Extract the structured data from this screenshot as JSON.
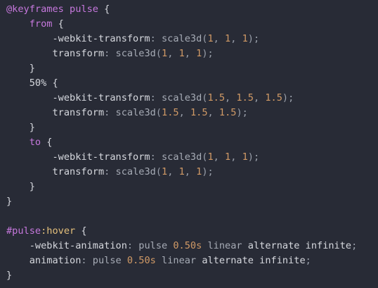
{
  "colors": {
    "background": "#282b36",
    "keyword": "#c678dd",
    "number": "#d19a66",
    "text": "#d6d8de",
    "muted": "#a7acb6",
    "pseudo": "#e5c07b"
  },
  "lines": [
    [
      {
        "t": "@keyframes",
        "c": "kw"
      },
      {
        "t": " "
      },
      {
        "t": "pulse",
        "c": "sel"
      },
      {
        "t": " {",
        "c": "plain"
      }
    ],
    [
      {
        "t": "    "
      },
      {
        "t": "from",
        "c": "kw"
      },
      {
        "t": " {",
        "c": "plain"
      }
    ],
    [
      {
        "t": "        "
      },
      {
        "t": "-webkit-transform",
        "c": "prop"
      },
      {
        "t": ": ",
        "c": "punc"
      },
      {
        "t": "scale3d",
        "c": "fn"
      },
      {
        "t": "(",
        "c": "punc"
      },
      {
        "t": "1",
        "c": "num"
      },
      {
        "t": ", ",
        "c": "punc"
      },
      {
        "t": "1",
        "c": "num"
      },
      {
        "t": ", ",
        "c": "punc"
      },
      {
        "t": "1",
        "c": "num"
      },
      {
        "t": ");",
        "c": "punc"
      }
    ],
    [
      {
        "t": "        "
      },
      {
        "t": "transform",
        "c": "prop"
      },
      {
        "t": ": ",
        "c": "punc"
      },
      {
        "t": "scale3d",
        "c": "fn"
      },
      {
        "t": "(",
        "c": "punc"
      },
      {
        "t": "1",
        "c": "num"
      },
      {
        "t": ", ",
        "c": "punc"
      },
      {
        "t": "1",
        "c": "num"
      },
      {
        "t": ", ",
        "c": "punc"
      },
      {
        "t": "1",
        "c": "num"
      },
      {
        "t": ");",
        "c": "punc"
      }
    ],
    [
      {
        "t": "    }",
        "c": "plain"
      }
    ],
    [
      {
        "t": "    "
      },
      {
        "t": "50%",
        "c": "plain"
      },
      {
        "t": " {",
        "c": "plain"
      }
    ],
    [
      {
        "t": "        "
      },
      {
        "t": "-webkit-transform",
        "c": "prop"
      },
      {
        "t": ": ",
        "c": "punc"
      },
      {
        "t": "scale3d",
        "c": "fn"
      },
      {
        "t": "(",
        "c": "punc"
      },
      {
        "t": "1.5",
        "c": "num"
      },
      {
        "t": ", ",
        "c": "punc"
      },
      {
        "t": "1.5",
        "c": "num"
      },
      {
        "t": ", ",
        "c": "punc"
      },
      {
        "t": "1.5",
        "c": "num"
      },
      {
        "t": ");",
        "c": "punc"
      }
    ],
    [
      {
        "t": "        "
      },
      {
        "t": "transform",
        "c": "prop"
      },
      {
        "t": ": ",
        "c": "punc"
      },
      {
        "t": "scale3d",
        "c": "fn"
      },
      {
        "t": "(",
        "c": "punc"
      },
      {
        "t": "1.5",
        "c": "num"
      },
      {
        "t": ", ",
        "c": "punc"
      },
      {
        "t": "1.5",
        "c": "num"
      },
      {
        "t": ", ",
        "c": "punc"
      },
      {
        "t": "1.5",
        "c": "num"
      },
      {
        "t": ");",
        "c": "punc"
      }
    ],
    [
      {
        "t": "    }",
        "c": "plain"
      }
    ],
    [
      {
        "t": "    "
      },
      {
        "t": "to",
        "c": "kw"
      },
      {
        "t": " {",
        "c": "plain"
      }
    ],
    [
      {
        "t": "        "
      },
      {
        "t": "-webkit-transform",
        "c": "prop"
      },
      {
        "t": ": ",
        "c": "punc"
      },
      {
        "t": "scale3d",
        "c": "fn"
      },
      {
        "t": "(",
        "c": "punc"
      },
      {
        "t": "1",
        "c": "num"
      },
      {
        "t": ", ",
        "c": "punc"
      },
      {
        "t": "1",
        "c": "num"
      },
      {
        "t": ", ",
        "c": "punc"
      },
      {
        "t": "1",
        "c": "num"
      },
      {
        "t": ");",
        "c": "punc"
      }
    ],
    [
      {
        "t": "        "
      },
      {
        "t": "transform",
        "c": "prop"
      },
      {
        "t": ": ",
        "c": "punc"
      },
      {
        "t": "scale3d",
        "c": "fn"
      },
      {
        "t": "(",
        "c": "punc"
      },
      {
        "t": "1",
        "c": "num"
      },
      {
        "t": ", ",
        "c": "punc"
      },
      {
        "t": "1",
        "c": "num"
      },
      {
        "t": ", ",
        "c": "punc"
      },
      {
        "t": "1",
        "c": "num"
      },
      {
        "t": ");",
        "c": "punc"
      }
    ],
    [
      {
        "t": "    }",
        "c": "plain"
      }
    ],
    [
      {
        "t": "}",
        "c": "plain"
      }
    ],
    [
      {
        "t": ""
      }
    ],
    [
      {
        "t": "#pulse",
        "c": "sel"
      },
      {
        "t": ":hover",
        "c": "pseudo"
      },
      {
        "t": " {",
        "c": "plain"
      }
    ],
    [
      {
        "t": "    "
      },
      {
        "t": "-webkit-animation",
        "c": "prop"
      },
      {
        "t": ": ",
        "c": "punc"
      },
      {
        "t": "pulse",
        "c": "val"
      },
      {
        "t": " "
      },
      {
        "t": "0.50s",
        "c": "num"
      },
      {
        "t": " "
      },
      {
        "t": "linear",
        "c": "val"
      },
      {
        "t": " "
      },
      {
        "t": "alternate",
        "c": "kwval"
      },
      {
        "t": " "
      },
      {
        "t": "infinite",
        "c": "kwval"
      },
      {
        "t": ";",
        "c": "punc"
      }
    ],
    [
      {
        "t": "    "
      },
      {
        "t": "animation",
        "c": "prop"
      },
      {
        "t": ": ",
        "c": "punc"
      },
      {
        "t": "pulse",
        "c": "val"
      },
      {
        "t": " "
      },
      {
        "t": "0.50s",
        "c": "num"
      },
      {
        "t": " "
      },
      {
        "t": "linear",
        "c": "val"
      },
      {
        "t": " "
      },
      {
        "t": "alternate",
        "c": "kwval"
      },
      {
        "t": " "
      },
      {
        "t": "infinite",
        "c": "kwval"
      },
      {
        "t": ";",
        "c": "punc"
      }
    ],
    [
      {
        "t": "}",
        "c": "plain"
      }
    ]
  ]
}
